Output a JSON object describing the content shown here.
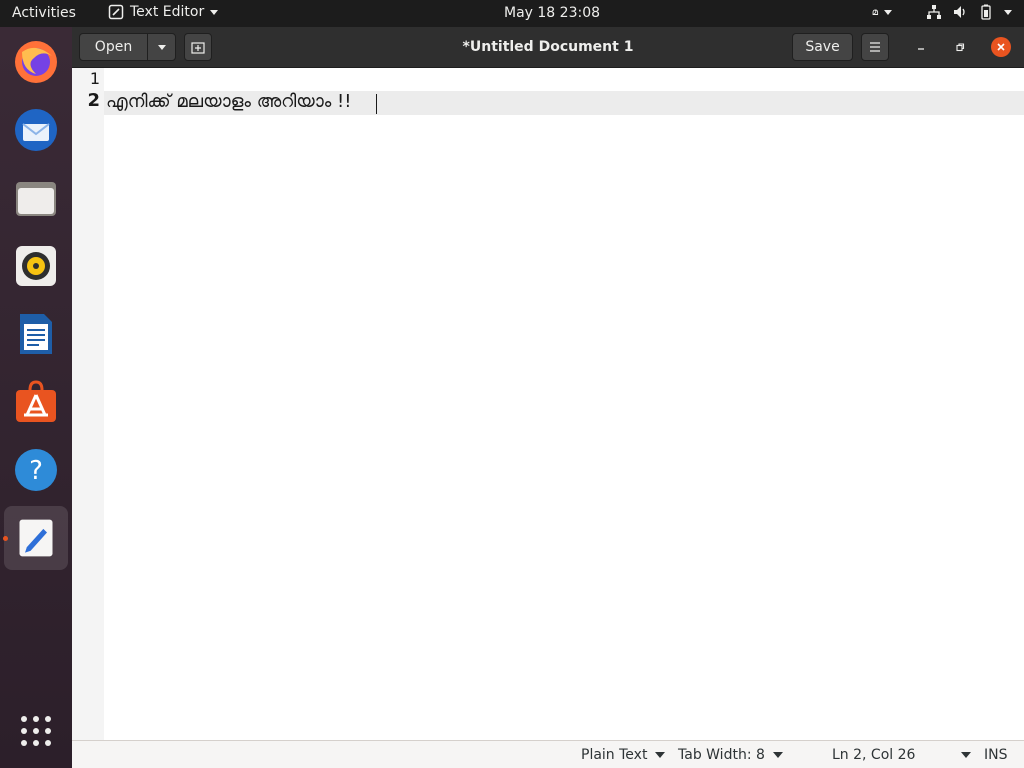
{
  "topbar": {
    "activities": "Activities",
    "app_name": "Text Editor",
    "clock": "May 18  23:08",
    "input_method": "മ"
  },
  "window": {
    "title": "*Untitled Document 1",
    "open_label": "Open",
    "save_label": "Save"
  },
  "editor": {
    "lines": [
      {
        "number": "1",
        "text": ""
      },
      {
        "number": "2",
        "text": "എനിക്ക് മലയാളം അറിയാം !!"
      }
    ]
  },
  "statusbar": {
    "language": "Plain Text",
    "tab_width": "Tab Width: 8",
    "position": "Ln 2, Col 26",
    "mode": "INS"
  },
  "colors": {
    "accent": "#e95420",
    "topbar_bg": "#1c1c1c",
    "headerbar_bg": "#2f2f2f"
  }
}
